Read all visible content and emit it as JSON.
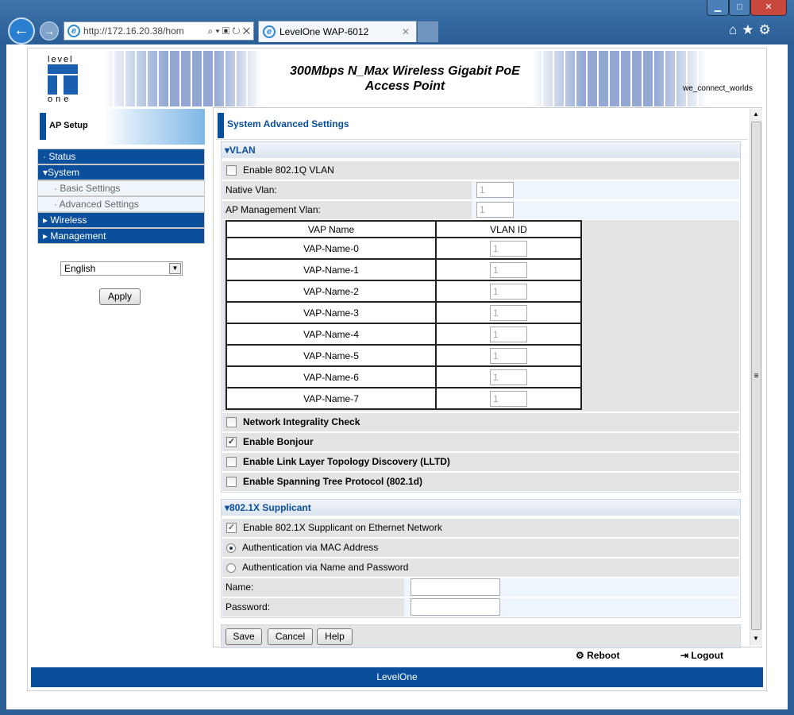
{
  "browser": {
    "url": "http://172.16.20.38/hom",
    "tab_title": "LevelOne WAP-6012"
  },
  "header": {
    "logo_top": "level",
    "logo_bottom": "one",
    "title": "300Mbps N_Max Wireless Gigabit PoE Access Point",
    "slogan": "we_connect_worlds"
  },
  "sidebar": {
    "heading": "AP Setup",
    "items": [
      {
        "label": "Status",
        "marker": "·"
      },
      {
        "label": "System",
        "marker": "▾"
      },
      {
        "label": "Basic Settings",
        "marker": "·"
      },
      {
        "label": "Advanced Settings",
        "marker": "·"
      },
      {
        "label": "Wireless",
        "marker": "▸"
      },
      {
        "label": "Management",
        "marker": "▸"
      }
    ],
    "language": "English",
    "apply": "Apply"
  },
  "main": {
    "title": "System Advanced Settings",
    "vlan": {
      "header": "VLAN",
      "enable_label": "Enable 802.1Q VLAN",
      "native_label": "Native Vlan:",
      "native_value": "1",
      "mgmt_label": "AP Management Vlan:",
      "mgmt_value": "1",
      "table_headers": [
        "VAP Name",
        "VLAN ID"
      ],
      "rows": [
        {
          "name": "VAP-Name-0",
          "id": "1"
        },
        {
          "name": "VAP-Name-1",
          "id": "1"
        },
        {
          "name": "VAP-Name-2",
          "id": "1"
        },
        {
          "name": "VAP-Name-3",
          "id": "1"
        },
        {
          "name": "VAP-Name-4",
          "id": "1"
        },
        {
          "name": "VAP-Name-5",
          "id": "1"
        },
        {
          "name": "VAP-Name-6",
          "id": "1"
        },
        {
          "name": "VAP-Name-7",
          "id": "1"
        }
      ],
      "options": [
        {
          "label": "Network Integrality Check",
          "checked": false
        },
        {
          "label": "Enable Bonjour",
          "checked": true
        },
        {
          "label": "Enable Link Layer Topology Discovery (LLTD)",
          "checked": false
        },
        {
          "label": "Enable Spanning Tree Protocol (802.1d)",
          "checked": false
        }
      ]
    },
    "supplicant": {
      "header": "802.1X Supplicant",
      "enable_label": "Enable 802.1X Supplicant on Ethernet Network",
      "enable_checked": true,
      "mac_label": "Authentication via MAC Address",
      "name_pw_label": "Authentication via Name and Password",
      "selected": "mac",
      "name_label": "Name:",
      "name_value": "",
      "password_label": "Password:",
      "password_value": ""
    },
    "buttons": {
      "save": "Save",
      "cancel": "Cancel",
      "help": "Help"
    }
  },
  "bottom": {
    "reboot": "Reboot",
    "logout": "Logout",
    "footer": "LevelOne"
  }
}
